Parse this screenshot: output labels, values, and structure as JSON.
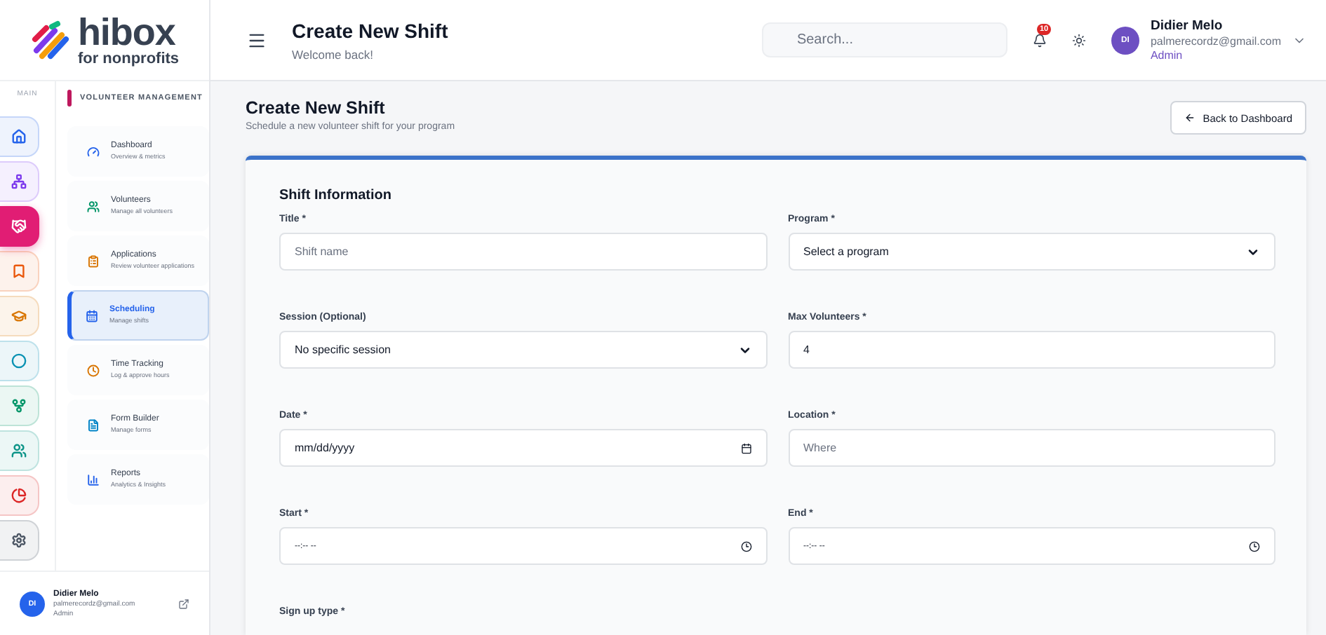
{
  "brand": {
    "name": "hibox",
    "tagline": "for nonprofits"
  },
  "rail": {
    "label": "MAIN",
    "items": [
      {
        "color": "#2563eb",
        "selected": false
      },
      {
        "color": "#7c3aed",
        "selected": false
      },
      {
        "color": "#e11d74",
        "selected": true
      },
      {
        "color": "#ea580c",
        "selected": false
      },
      {
        "color": "#d97706",
        "selected": false
      },
      {
        "color": "#0891b2",
        "selected": false
      },
      {
        "color": "#059669",
        "selected": false
      },
      {
        "color": "#0d9488",
        "selected": false
      },
      {
        "color": "#dc2626",
        "selected": false
      },
      {
        "color": "#4b5563",
        "selected": false
      }
    ]
  },
  "nav": {
    "section": "VOLUNTEER MANAGEMENT",
    "items": [
      {
        "color": "#2563eb",
        "title": "Dashboard",
        "subtitle": "Overview & metrics",
        "selected": false
      },
      {
        "color": "#059669",
        "title": "Volunteers",
        "subtitle": "Manage all volunteers",
        "selected": false
      },
      {
        "color": "#d97706",
        "title": "Applications",
        "subtitle": "Review volunteer applications",
        "selected": false
      },
      {
        "color": "#2563eb",
        "title": "Scheduling",
        "subtitle": "Manage shifts",
        "selected": true
      },
      {
        "color": "#d97706",
        "title": "Time Tracking",
        "subtitle": "Log & approve hours",
        "selected": false
      },
      {
        "color": "#0284c7",
        "title": "Form Builder",
        "subtitle": "Manage forms",
        "selected": false
      },
      {
        "color": "#2563eb",
        "title": "Reports",
        "subtitle": "Analytics & Insights",
        "selected": false
      }
    ]
  },
  "sidebar_user": {
    "initials": "DI",
    "name": "Didier Melo",
    "email": "palmerecordz@gmail.com",
    "role": "Admin"
  },
  "header": {
    "title": "Create New Shift",
    "subtitle": "Welcome back!",
    "search": {
      "placeholder": "Search..."
    },
    "notification_count": "10",
    "user": {
      "initials": "DI",
      "name": "Didier Melo",
      "email": "palmerecordz@gmail.com",
      "role": "Admin"
    }
  },
  "page": {
    "title": "Create New Shift",
    "subtitle": "Schedule a new volunteer shift for your program",
    "back_button": "Back to Dashboard"
  },
  "form": {
    "section": "Shift Information",
    "fields": [
      {
        "label": "Title *",
        "kind": "text",
        "placeholder": "Shift name"
      },
      {
        "label": "Program *",
        "kind": "select",
        "value": "Select a program"
      },
      {
        "label": "Session (Optional)",
        "kind": "select",
        "value": "No specific session"
      },
      {
        "label": "Max Volunteers *",
        "kind": "text",
        "value": "4"
      },
      {
        "label": "Date *",
        "kind": "date",
        "placeholder": "mm/dd/yyyy"
      },
      {
        "label": "Location *",
        "kind": "text",
        "placeholder": "Where"
      },
      {
        "label": "Start *",
        "kind": "time",
        "placeholder": "--:-- --"
      },
      {
        "label": "End *",
        "kind": "time",
        "placeholder": "--:-- --"
      },
      {
        "label": "Sign up type *",
        "kind": "label"
      }
    ]
  }
}
